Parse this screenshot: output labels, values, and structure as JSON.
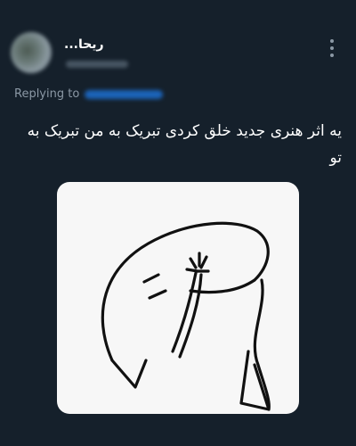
{
  "tweet": {
    "author_name": "ریحا...",
    "replying_to_label": "Replying to",
    "text": "یه اثر هنری جدید خلق کردی تبریک به من تبریک به تو",
    "image_alt": "flork doodle sticker",
    "more_icon": "more-vertical-icon"
  },
  "colors": {
    "background": "#15202b",
    "text_primary": "#ffffff",
    "text_secondary": "#8b98a5",
    "link": "#1d9bf0"
  }
}
